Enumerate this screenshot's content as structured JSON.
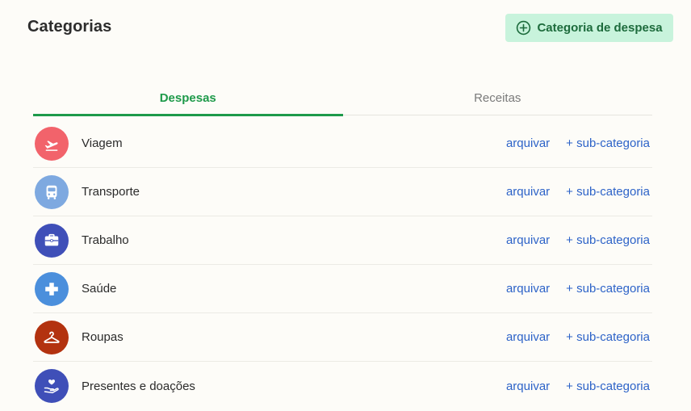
{
  "header": {
    "title": "Categorias",
    "add_button_label": "Categoria de despesa",
    "add_button_icon": "plus-circle-icon"
  },
  "tabs": [
    {
      "label": "Despesas",
      "active": true
    },
    {
      "label": "Receitas",
      "active": false
    }
  ],
  "categories": [
    {
      "name": "Viagem",
      "icon": "airplane-takeoff-icon",
      "color": "#f2636b",
      "archive_label": "arquivar",
      "sub_label": "+ sub-categoria"
    },
    {
      "name": "Transporte",
      "icon": "bus-icon",
      "color": "#7ea9e0",
      "archive_label": "arquivar",
      "sub_label": "+ sub-categoria"
    },
    {
      "name": "Trabalho",
      "icon": "briefcase-icon",
      "color": "#3f4fb8",
      "archive_label": "arquivar",
      "sub_label": "+ sub-categoria"
    },
    {
      "name": "Saúde",
      "icon": "health-cross-icon",
      "color": "#4b8fdc",
      "archive_label": "arquivar",
      "sub_label": "+ sub-categoria"
    },
    {
      "name": "Roupas",
      "icon": "hanger-icon",
      "color": "#b3320f",
      "archive_label": "arquivar",
      "sub_label": "+ sub-categoria"
    },
    {
      "name": "Presentes e doações",
      "icon": "hand-heart-icon",
      "color": "#3f4fb8",
      "archive_label": "arquivar",
      "sub_label": "+ sub-categoria"
    }
  ],
  "colors": {
    "accent": "#1e9a4a",
    "link": "#2d63c8",
    "add_button_bg": "#c8f3dc"
  }
}
